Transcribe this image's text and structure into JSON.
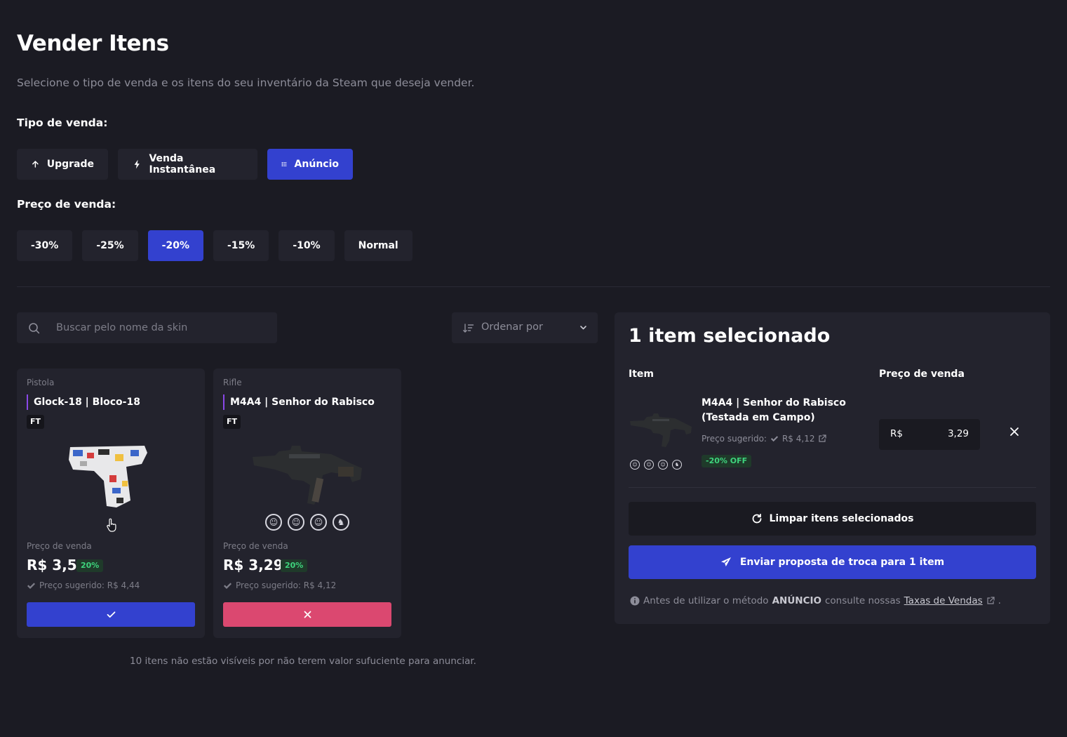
{
  "header": {
    "title": "Vender Itens",
    "subtitle": "Selecione o tipo de venda e os itens do seu inventário da Steam que deseja vender."
  },
  "sale_type": {
    "label": "Tipo de venda:",
    "options": [
      "Upgrade",
      "Venda Instantânea",
      "Anúncio"
    ],
    "selected": "Anúncio"
  },
  "sale_price": {
    "label": "Preço de venda:",
    "options": [
      "-30%",
      "-25%",
      "-20%",
      "-15%",
      "-10%",
      "Normal"
    ],
    "selected": "-20%"
  },
  "search": {
    "placeholder": "Buscar pelo nome da skin"
  },
  "sort": {
    "label": "Ordenar por"
  },
  "items": [
    {
      "category": "Pistola",
      "name": "Glock-18 | Bloco-18",
      "wear": "FT",
      "price_label": "Preço de venda",
      "price": "R$ 3,55",
      "discount": "20%",
      "suggested": "Preço sugerido: R$ 4,44",
      "selected": false
    },
    {
      "category": "Rifle",
      "name": "M4A4 | Senhor do Rabisco",
      "wear": "FT",
      "price_label": "Preço de venda",
      "price": "R$ 3,29",
      "discount": "20%",
      "suggested": "Preço sugerido: R$ 4,12",
      "selected": true
    }
  ],
  "hidden_note": "10 itens não estão visíveis por não terem valor sufuciente para anunciar.",
  "panel": {
    "title": "1 item selecionado",
    "col_item": "Item",
    "col_price": "Preço de venda",
    "selected_item": {
      "name": "M4A4 | Senhor do Rabisco (Testada em Campo)",
      "suggested_label": "Preço sugerido:",
      "suggested_value": "R$ 4,12",
      "off_badge": "-20% OFF",
      "currency": "R$",
      "price": "3,29"
    },
    "clear_label": "Limpar itens selecionados",
    "send_label": "Enviar proposta de troca para 1 item",
    "note_prefix": "Antes de utilizar o método",
    "note_method": "ANÚNCIO",
    "note_middle": "consulte nossas",
    "note_link": "Taxas de Vendas",
    "note_suffix": "."
  },
  "colors": {
    "background": "#1b1b23",
    "surface": "#23232d",
    "accent": "#3341cf",
    "danger": "#db4870",
    "success": "#3ed47d",
    "rarity": "#8a48e8"
  }
}
